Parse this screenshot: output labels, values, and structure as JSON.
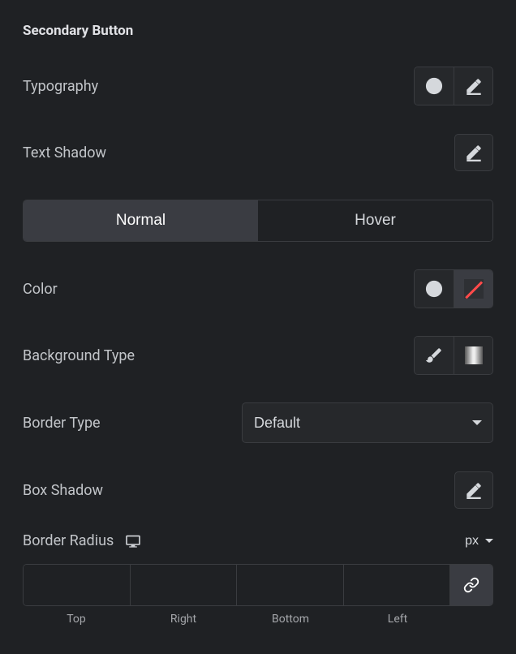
{
  "section_title": "Secondary Button",
  "typography": {
    "label": "Typography"
  },
  "text_shadow": {
    "label": "Text Shadow"
  },
  "tabs": {
    "normal": "Normal",
    "hover": "Hover",
    "active": "normal"
  },
  "color": {
    "label": "Color",
    "value": "none"
  },
  "background_type": {
    "label": "Background Type",
    "selected": "classic"
  },
  "border_type": {
    "label": "Border Type",
    "value": "Default"
  },
  "box_shadow": {
    "label": "Box Shadow"
  },
  "border_radius": {
    "label": "Border Radius",
    "unit": "px",
    "linked": true,
    "values": {
      "top": "",
      "right": "",
      "bottom": "",
      "left": ""
    },
    "side_labels": {
      "top": "Top",
      "right": "Right",
      "bottom": "Bottom",
      "left": "Left"
    }
  }
}
